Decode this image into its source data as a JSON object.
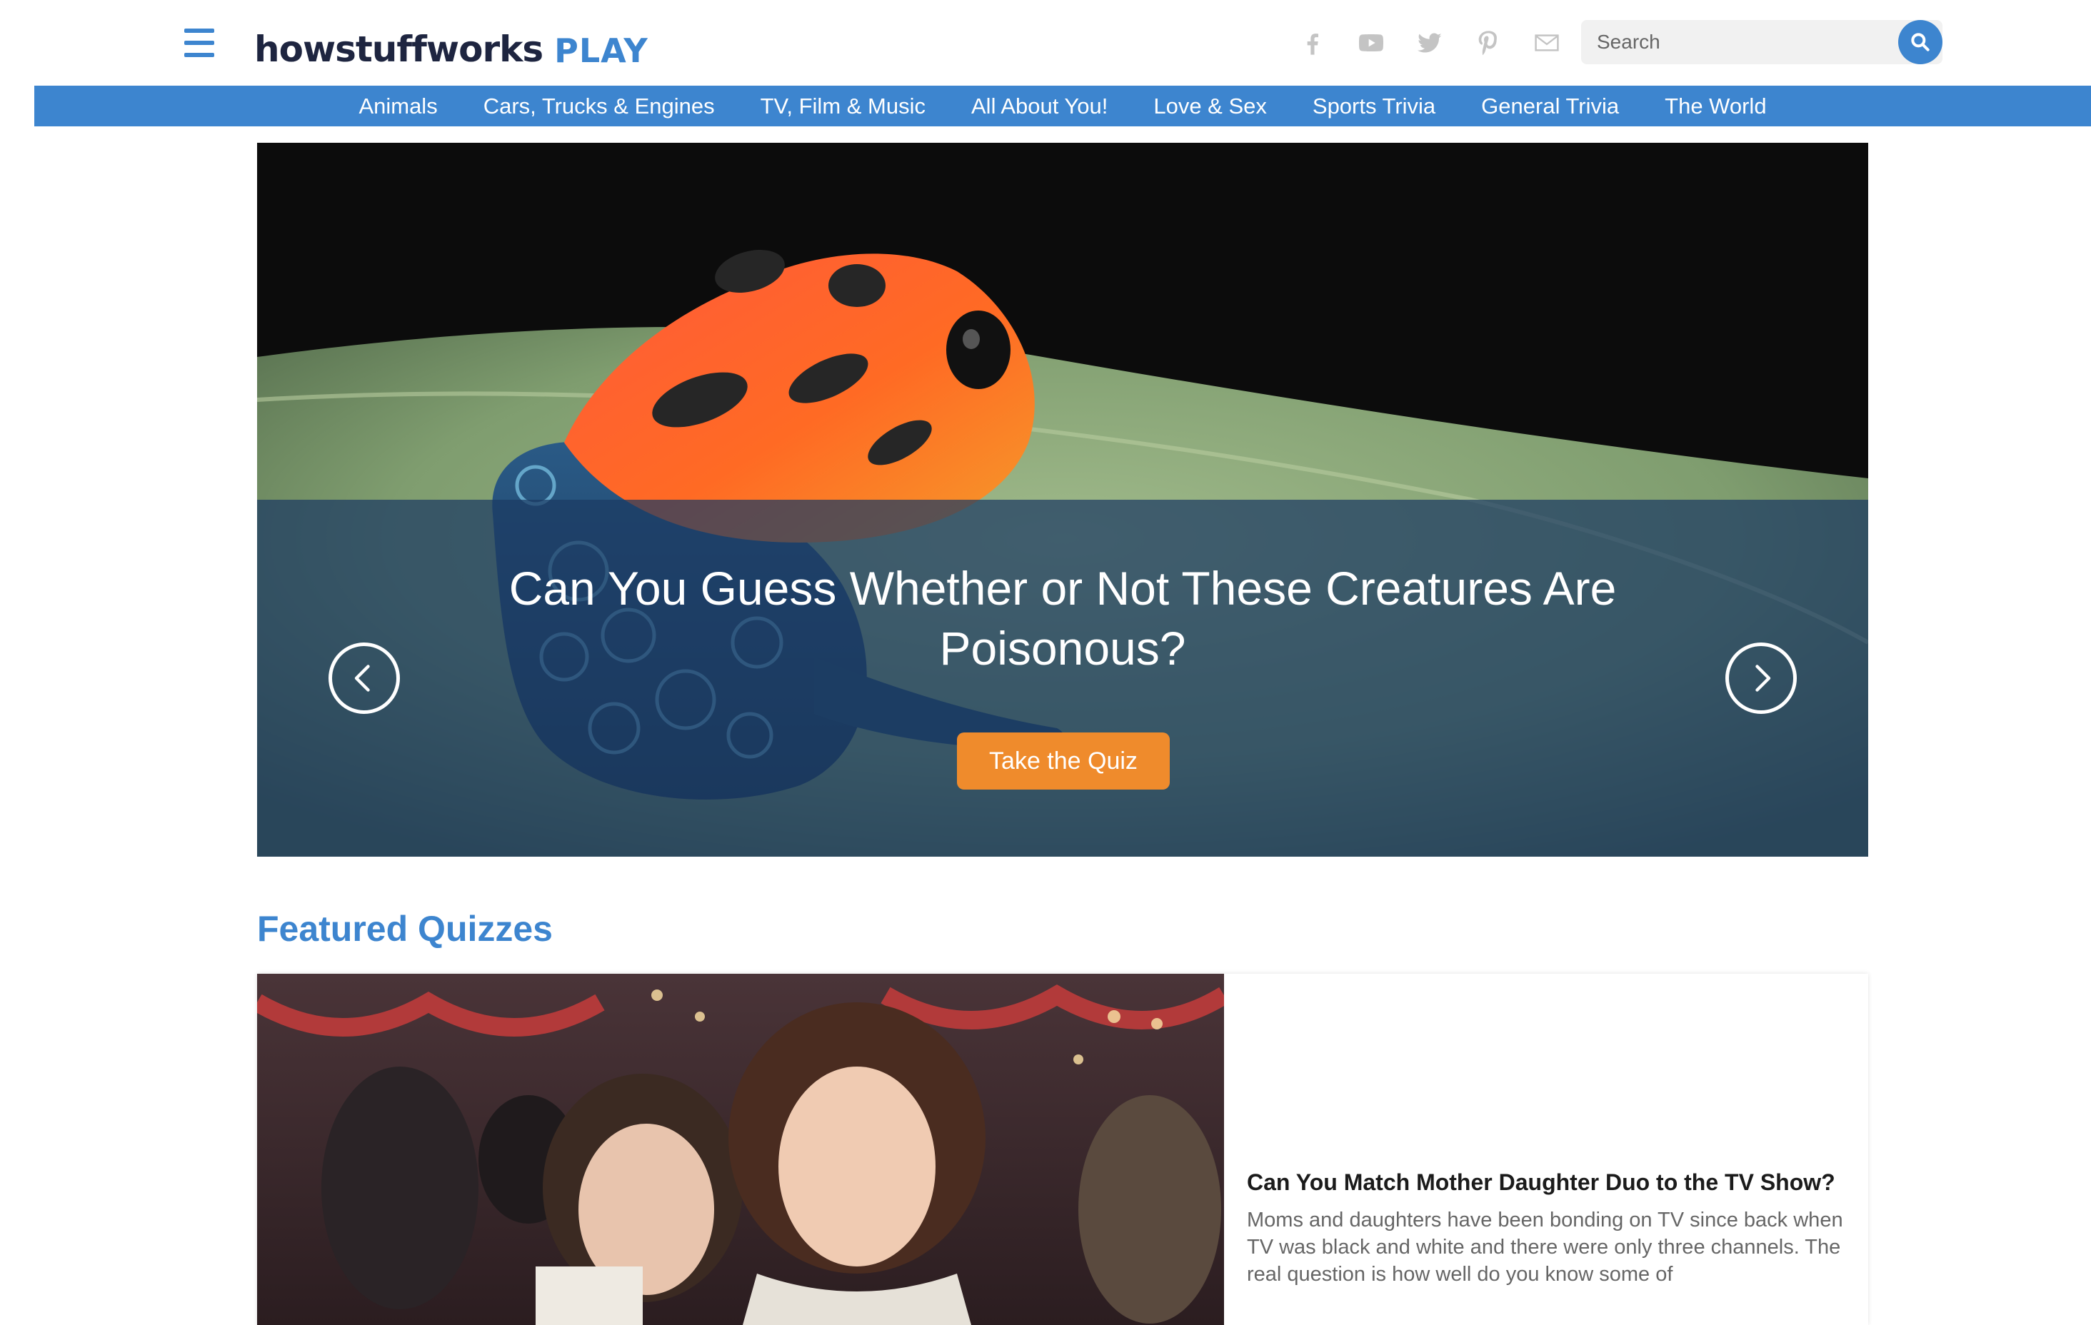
{
  "header": {
    "brand_main": "howstuffworks",
    "brand_sub": "PLAY",
    "search_placeholder": "Search",
    "social_icons": [
      "facebook-icon",
      "youtube-icon",
      "twitter-icon",
      "pinterest-icon",
      "email-icon"
    ]
  },
  "nav": {
    "items": [
      {
        "label": "Animals"
      },
      {
        "label": "Cars, Trucks & Engines"
      },
      {
        "label": "TV, Film & Music"
      },
      {
        "label": "All About You!"
      },
      {
        "label": "Love & Sex"
      },
      {
        "label": "Sports Trivia"
      },
      {
        "label": "General Trivia"
      },
      {
        "label": "The World"
      }
    ]
  },
  "hero": {
    "title": "Can You Guess Whether or Not These Creatures Are Poisonous?",
    "cta_label": "Take the Quiz",
    "prev_icon": "chevron-left-icon",
    "next_icon": "chevron-right-icon"
  },
  "featured": {
    "heading": "Featured Quizzes",
    "cards": [
      {
        "title": "Can You Match Mother Daughter Duo to the TV Show?",
        "description": "Moms and daughters have been bonding on TV since back when TV was black and white and there were only three channels. The real question is how well do you know some of"
      }
    ]
  },
  "colors": {
    "brand_blue": "#3d85cf",
    "brand_dark": "#1e2540",
    "cta_orange": "#ef8b2c",
    "hero_overlay": "#1c3a62"
  }
}
